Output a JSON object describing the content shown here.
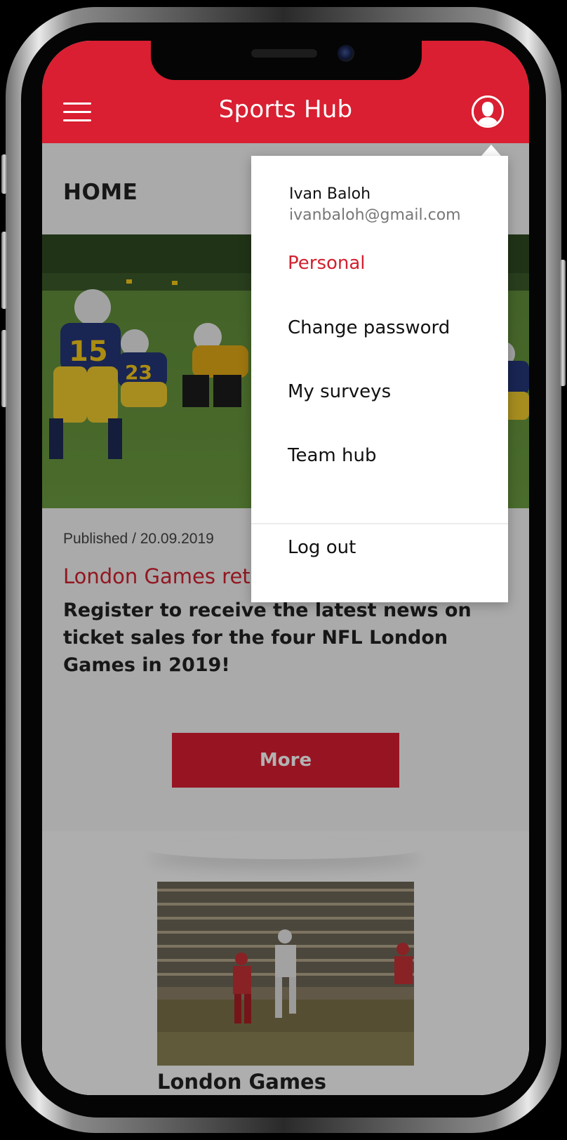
{
  "header": {
    "title": "Sports Hub",
    "accent_color": "#d91f31",
    "menu_icon": "hamburger-icon",
    "profile_icon": "user-avatar-icon"
  },
  "page": {
    "title": "HOME"
  },
  "article": {
    "published": "Published / 20.09.2019",
    "title": "London Games returns in 2019",
    "body": "Register to receive the latest news on ticket sales for the four NFL London Games in 2019!",
    "more_label": "More"
  },
  "next_card": {
    "title": "London Games"
  },
  "profile_menu": {
    "user_name": "Ivan Baloh",
    "user_email": "ivanbaloh@gmail.com",
    "items": [
      {
        "label": "Personal",
        "active": true
      },
      {
        "label": "Change password",
        "active": false
      },
      {
        "label": "My surveys",
        "active": false
      },
      {
        "label": "Team hub",
        "active": false
      }
    ],
    "logout_label": "Log out"
  }
}
